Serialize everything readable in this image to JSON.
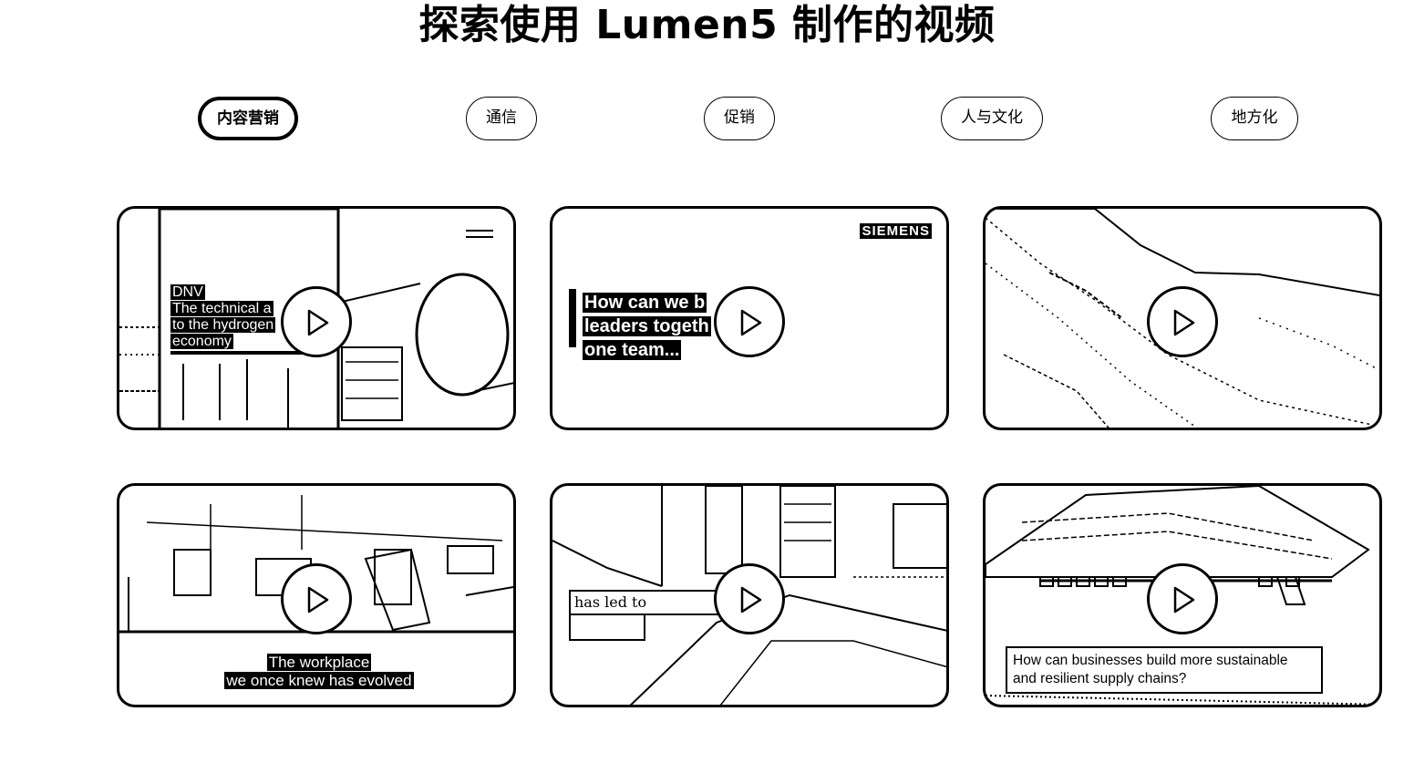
{
  "page": {
    "title": "探索使用 Lumen5 制作的视频"
  },
  "tabs": [
    {
      "label": "内容营销",
      "active": true
    },
    {
      "label": "通信",
      "active": false
    },
    {
      "label": "促销",
      "active": false
    },
    {
      "label": "人与文化",
      "active": false
    },
    {
      "label": "地方化",
      "active": false
    }
  ],
  "videos": [
    {
      "brand": "DNV",
      "caption_lines": [
        "The technical a",
        "to the hydrogen",
        "economy"
      ]
    },
    {
      "brand": "SIEMENS",
      "caption_lines": [
        "How can we b",
        "leaders togeth",
        "one team..."
      ]
    },
    {
      "brand": "",
      "caption_lines": []
    },
    {
      "brand": "",
      "caption_lines": [
        "The workplace",
        "we once knew has evolved"
      ]
    },
    {
      "brand": "",
      "caption_lines": [
        "has led to"
      ]
    },
    {
      "brand": "",
      "caption_lines": [
        "How can businesses build more sustainable",
        "and resilient supply chains?"
      ]
    }
  ]
}
